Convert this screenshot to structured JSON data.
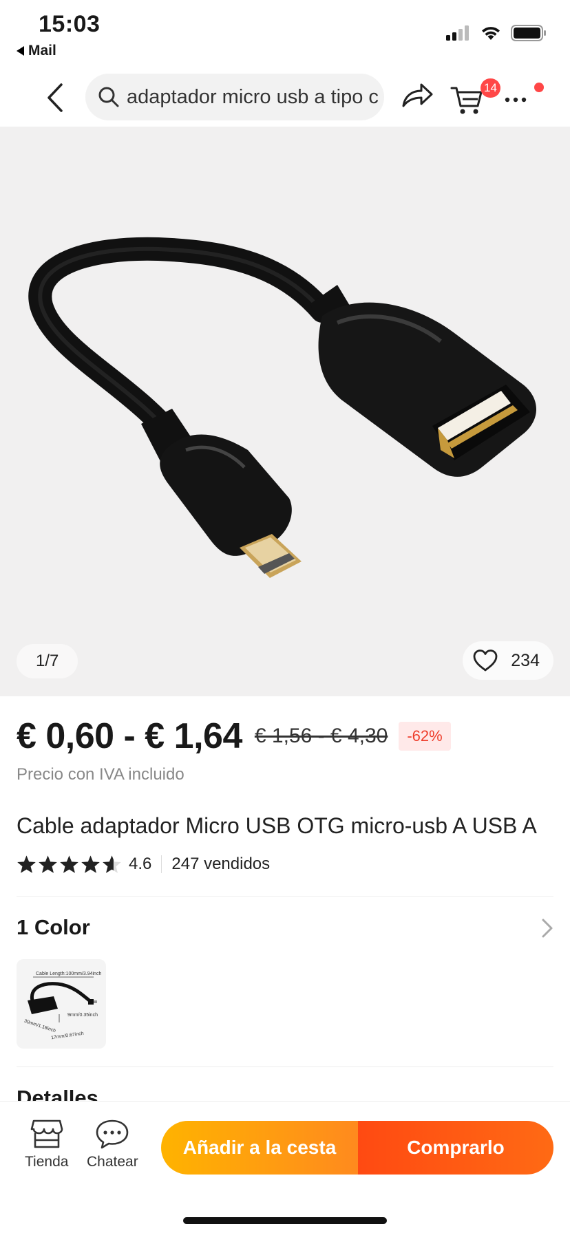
{
  "status_bar": {
    "time": "15:03",
    "back_app_label": "Mail"
  },
  "header": {
    "search_text": "adaptador micro usb a tipo c",
    "cart_count": "14"
  },
  "gallery": {
    "counter": "1/7",
    "wishlist_count": "234"
  },
  "pricing": {
    "price_range": "€ 0,60 - € 1,64",
    "original_price_range": "€ 1,56 - € 4,30",
    "discount": "-62%",
    "vat_note": "Precio con IVA incluido"
  },
  "product": {
    "title": "Cable adaptador Micro USB OTG micro-usb A USB A",
    "rating": "4.6",
    "stars_filled": 4.6,
    "sold": "247 vendidos"
  },
  "variants": {
    "title": "1 Color",
    "thumb_labels": [
      "Cable Length:100mm/3.94inch",
      "9mm/0.35inch",
      "30mm/1.18inch",
      "17mm/0.67inch"
    ]
  },
  "details": {
    "title": "Detalles"
  },
  "bottom_bar": {
    "store_label": "Tienda",
    "chat_label": "Chatear",
    "add_to_cart": "Añadir a la cesta",
    "buy_now": "Comprarlo"
  },
  "colors": {
    "accent": "#ff4747",
    "discount_text": "#ee3d2b",
    "cta_add_start": "#ffb300",
    "cta_buy_start": "#ff4a12"
  }
}
